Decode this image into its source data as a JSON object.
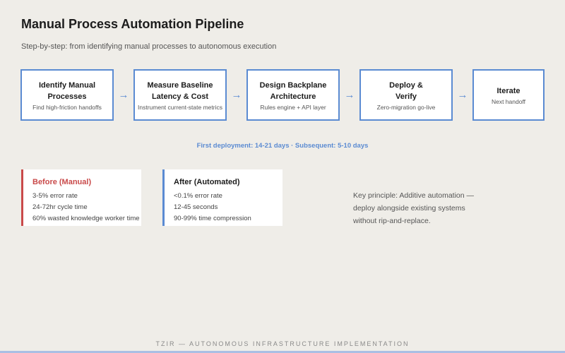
{
  "header": {
    "title": "Manual Process Automation Pipeline",
    "subtitle": "Step-by-step: from identifying manual processes to autonomous execution"
  },
  "steps": [
    {
      "title_lines": [
        "Identify Manual",
        "Processes"
      ],
      "desc": "Find high-friction handoffs"
    },
    {
      "title_lines": [
        "Measure Baseline",
        "Latency & Cost"
      ],
      "desc": "Instrument current-state metrics"
    },
    {
      "title_lines": [
        "Design Backplane",
        "Architecture"
      ],
      "desc": "Rules engine + API layer"
    },
    {
      "title_lines": [
        "Deploy &",
        "Verify"
      ],
      "desc": "Zero-migration go-live"
    },
    {
      "title_lines": [
        "Iterate"
      ],
      "desc": "Next handoff"
    }
  ],
  "arrow_glyph": "→",
  "timeline_note": "First deployment: 14-21 days · Subsequent: 5-10 days",
  "comparison": {
    "before": {
      "title": "Before (Manual)",
      "lines": [
        "3-5% error rate",
        "24-72hr cycle time",
        "60% wasted knowledge worker time"
      ]
    },
    "after": {
      "title": "After (Automated)",
      "lines": [
        "<0.1% error rate",
        "12-45 seconds",
        "90-99% time compression"
      ]
    }
  },
  "principle": {
    "lines": [
      "Key principle: Additive automation —",
      "deploy alongside existing systems",
      "without rip-and-replace."
    ]
  },
  "footer": "TZIR — AUTONOMOUS INFRASTRUCTURE IMPLEMENTATION",
  "colors": {
    "accent": "#5b8bd2",
    "before_accent": "#c94a4a",
    "background": "#efede8"
  }
}
